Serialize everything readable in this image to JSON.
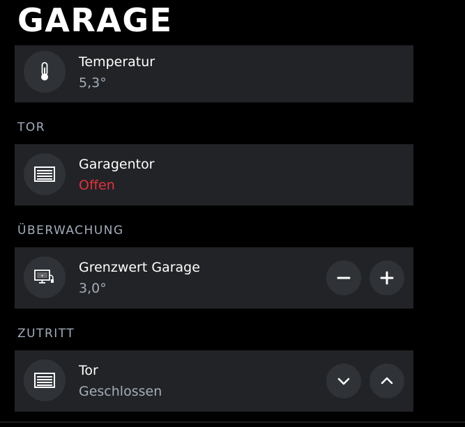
{
  "page": {
    "title": "GARAGE"
  },
  "colors": {
    "background": "#000000",
    "card": "#222326",
    "icon_bg": "#2f3237",
    "text_primary": "#ffffff",
    "text_secondary": "#a3adbb",
    "alert": "#e5303e"
  },
  "cards": {
    "temperature": {
      "icon": "thermometer-icon",
      "title": "Temperatur",
      "value": "5,3°"
    },
    "garage_door": {
      "icon": "garage-door-icon",
      "title": "Garagentor",
      "value": "Offen"
    },
    "threshold": {
      "icon": "monitor-plug-icon",
      "title": "Grenzwert Garage",
      "value": "3,0°",
      "decrease_icon": "minus-icon",
      "increase_icon": "plus-icon"
    },
    "gate": {
      "icon": "garage-door-icon",
      "title": "Tor",
      "value": "Geschlossen",
      "close_icon": "chevron-down-icon",
      "open_icon": "chevron-up-icon"
    }
  },
  "sections": {
    "tor": "TOR",
    "ueberwachung": "ÜBERWACHUNG",
    "zutritt": "ZUTRITT"
  }
}
